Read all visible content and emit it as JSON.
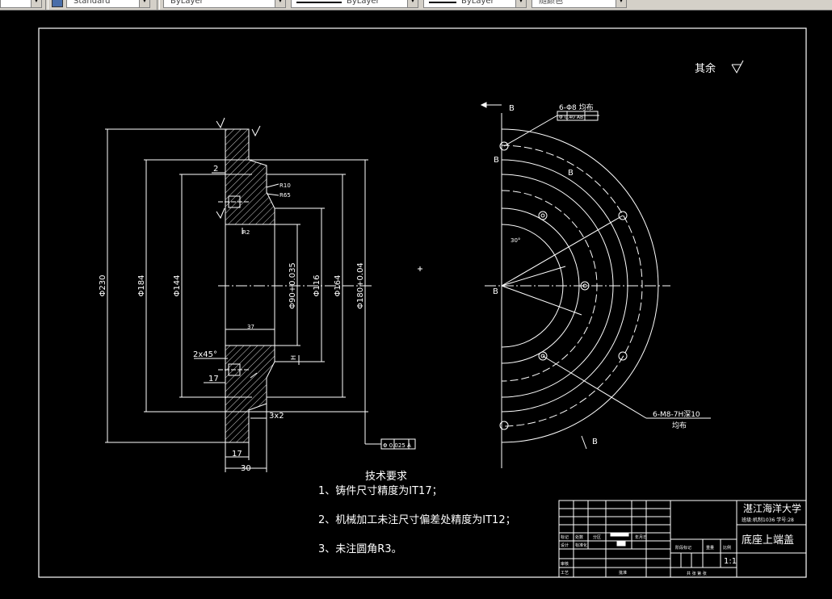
{
  "toolbar": {
    "text_style": "Standard",
    "layer_label": "ByLayer",
    "linetype_label": "ByLayer",
    "lineweight_label": "ByLayer",
    "color_label": "随颜色"
  },
  "drawing": {
    "surface_roughness": "其余",
    "views": {
      "section_marker": "B",
      "hole_callout": "6-Φ8 均布",
      "hole_tolerance": "Φ 0.40 AB",
      "thread_callout": "6-M8-7H深10",
      "thread_note": "均布",
      "angle_label": "30°",
      "position_tolerance": "Φ 0.025 A",
      "datum_a": "A",
      "datum_h": "H"
    },
    "dimensions": {
      "d230": "Φ230",
      "d184": "Φ184",
      "d144": "Φ144",
      "d90": "Φ90+0.035",
      "d116": "Φ116",
      "d164": "Φ164",
      "d180": "Φ180+0.04",
      "dim_2": "2",
      "dim_17a": "17",
      "dim_17b": "17",
      "dim_30": "30",
      "dim_37": "37",
      "chamfer": "2x45°",
      "groove": "3x2",
      "r10": "R10",
      "r65": "R65",
      "r2": "R2"
    },
    "tech_requirements": {
      "title": "技术要求",
      "items": [
        "1、铸件尺寸精度为IT17；",
        "2、机械加工未注尺寸偏差处精度为IT12；",
        "3、未注圆角R3。"
      ]
    },
    "title_block": {
      "university": "湛江海洋大学",
      "class_info": "班级:机制1036 学号:28",
      "part_name": "底座上端盖",
      "scale": "1:1",
      "labels": {
        "mark": "标记",
        "count": "处数",
        "zone": "分区",
        "change_doc": "更改文件号",
        "sign": "签名",
        "date": "年月日",
        "design": "设计",
        "standard": "标准化",
        "stage": "阶段标记",
        "weight": "重量",
        "ratio": "比例",
        "review": "审核",
        "process": "工艺",
        "approve": "批准",
        "sheets": "共 张 第 张"
      }
    }
  },
  "colors": {
    "background": "#000000",
    "lines": "#ffffff",
    "toolbar": "#d4d0c8"
  }
}
